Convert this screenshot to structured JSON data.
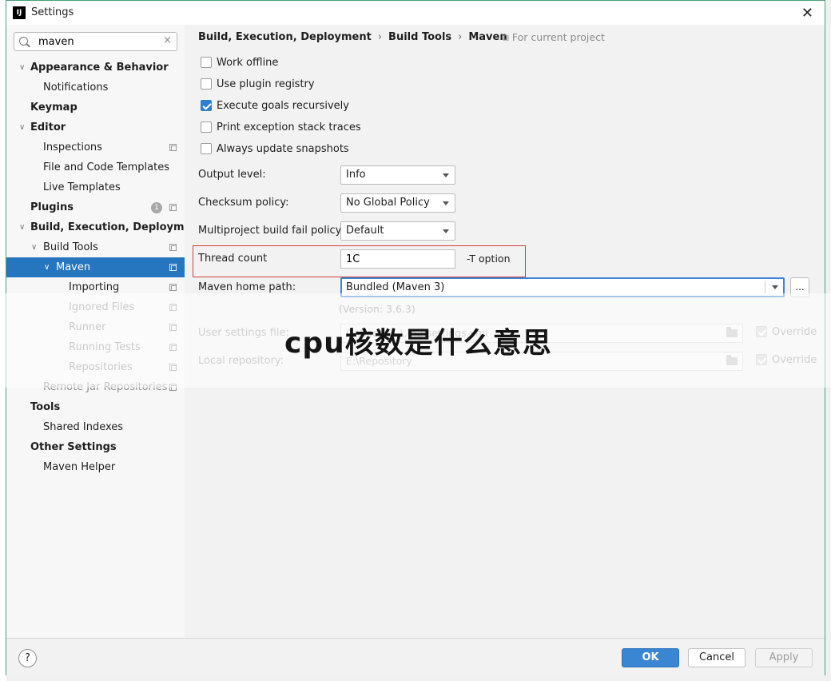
{
  "window": {
    "title": "Settings",
    "app_logo_text": "IJ"
  },
  "search": {
    "value": "maven",
    "clear_glyph": "×"
  },
  "tree": [
    {
      "label": "Appearance & Behavior",
      "arrow": "∨",
      "bold": true
    },
    {
      "label": "Notifications",
      "bold": false
    },
    {
      "label": "Keymap",
      "bold": true
    },
    {
      "label": "Editor",
      "arrow": "∨",
      "bold": true
    },
    {
      "label": "Inspections",
      "bold": false
    },
    {
      "label": "File and Code Templates",
      "bold": false
    },
    {
      "label": "Live Templates",
      "bold": false
    },
    {
      "label": "Plugins",
      "bold": true,
      "badge": "1"
    },
    {
      "label": "Build, Execution, Deployment",
      "arrow": "∨",
      "bold": true
    },
    {
      "label": "Build Tools",
      "arrow": "∨",
      "bold": false
    },
    {
      "label": "Maven",
      "arrow": "∨",
      "bold": false,
      "selected": true
    },
    {
      "label": "Importing",
      "bold": false
    },
    {
      "label": "Ignored Files",
      "bold": false
    },
    {
      "label": "Runner",
      "bold": false
    },
    {
      "label": "Running Tests",
      "bold": false
    },
    {
      "label": "Repositories",
      "bold": false
    },
    {
      "label": "Remote Jar Repositories",
      "bold": false
    },
    {
      "label": "Tools",
      "bold": true
    },
    {
      "label": "Shared Indexes",
      "bold": false
    },
    {
      "label": "Other Settings",
      "bold": true
    },
    {
      "label": "Maven Helper",
      "bold": false
    }
  ],
  "breadcrumb": {
    "parts": [
      "Build, Execution, Deployment",
      "Build Tools",
      "Maven"
    ],
    "separator": "›",
    "for_project": "For current project"
  },
  "options": [
    {
      "label": "Work offline",
      "checked": false
    },
    {
      "label": "Use plugin registry",
      "checked": false
    },
    {
      "label": "Execute goals recursively",
      "checked": true
    },
    {
      "label": "Print exception stack traces",
      "checked": false
    },
    {
      "label": "Always update snapshots",
      "checked": false
    }
  ],
  "fields": {
    "output_level": {
      "label": "Output level:",
      "value": "Info"
    },
    "checksum_policy": {
      "label": "Checksum policy:",
      "value": "No Global Policy"
    },
    "fail_policy": {
      "label": "Multiproject build fail policy:",
      "value": "Default"
    },
    "thread_count": {
      "label": "Thread count",
      "value": "1C",
      "hint": "-T option"
    },
    "maven_home": {
      "label": "Maven home path:",
      "value": "Bundled (Maven 3)",
      "browse": "..."
    },
    "version": "(Version: 3.6.3)",
    "user_settings": {
      "label": "User settings file:",
      "value": "C:\\Users\\...\\.m2\\settings.xml",
      "override": "Override"
    },
    "local_repo": {
      "label": "Local repository:",
      "value": "E:\\Repository",
      "override": "Override"
    }
  },
  "watermark": "cpu核数是什么意思",
  "footer": {
    "help": "?",
    "ok": "OK",
    "cancel": "Cancel",
    "apply": "Apply"
  },
  "colors": {
    "selection": "#2675bf",
    "primary_button": "#3a86d2",
    "highlight_box": "#d23f3f"
  }
}
